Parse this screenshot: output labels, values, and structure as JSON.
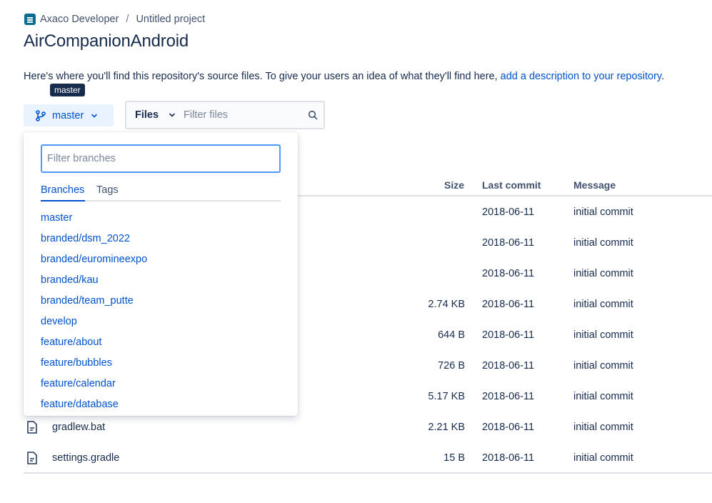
{
  "breadcrumb": {
    "org": "Axaco Developer",
    "separator": "/",
    "project": "Untitled project"
  },
  "page_title": "AirCompanionAndroid",
  "intro": {
    "text": "Here's where you'll find this repository's source files. To give your users an idea of what they'll find here, ",
    "link": "add a description to your repository",
    "suffix": "."
  },
  "tooltip": "master",
  "branch_button": {
    "label": "master"
  },
  "files_filter": {
    "mode_label": "Files",
    "placeholder": "Filter files"
  },
  "table": {
    "headers": {
      "size": "Size",
      "last_commit": "Last commit",
      "message": "Message"
    },
    "rows": [
      {
        "name": "",
        "size": "",
        "date": "2018-06-11",
        "message": "initial commit"
      },
      {
        "name": "",
        "size": "",
        "date": "2018-06-11",
        "message": "initial commit"
      },
      {
        "name": "",
        "size": "",
        "date": "2018-06-11",
        "message": "initial commit"
      },
      {
        "name": "",
        "size": "2.74 KB",
        "date": "2018-06-11",
        "message": "initial commit"
      },
      {
        "name": "",
        "size": "644 B",
        "date": "2018-06-11",
        "message": "initial commit"
      },
      {
        "name": "",
        "size": "726 B",
        "date": "2018-06-11",
        "message": "initial commit"
      },
      {
        "name": "",
        "size": "5.17 KB",
        "date": "2018-06-11",
        "message": "initial commit"
      },
      {
        "name": "gradlew.bat",
        "size": "2.21 KB",
        "date": "2018-06-11",
        "message": "initial commit"
      },
      {
        "name": "settings.gradle",
        "size": "15 B",
        "date": "2018-06-11",
        "message": "initial commit"
      }
    ]
  },
  "dropdown": {
    "filter_placeholder": "Filter branches",
    "tabs": [
      "Branches",
      "Tags"
    ],
    "active_tab": "Branches",
    "branches": [
      "master",
      "branded/dsm_2022",
      "branded/euromineexpo",
      "branded/kau",
      "branded/team_putte",
      "develop",
      "feature/about",
      "feature/bubbles",
      "feature/calendar",
      "feature/database"
    ]
  },
  "colors": {
    "link": "#0052cc",
    "text": "#172b4d",
    "focus": "#4c9aff",
    "tooltip_bg": "#172b4d"
  }
}
